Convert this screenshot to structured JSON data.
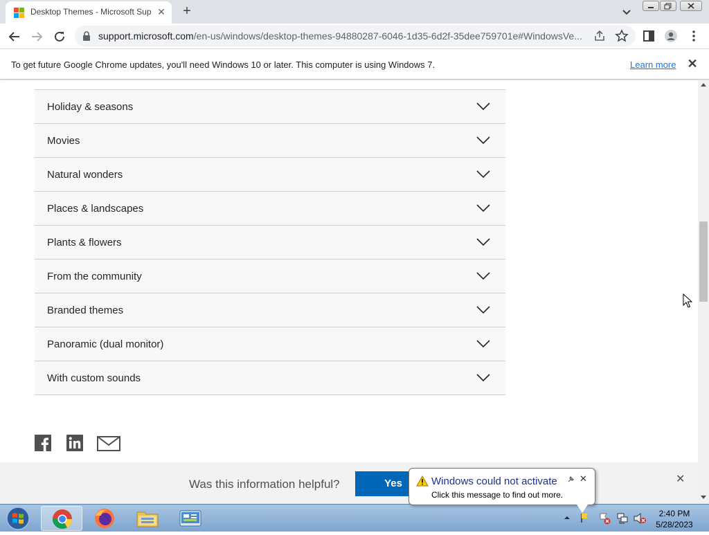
{
  "browser": {
    "tab": {
      "title": "Desktop Themes - Microsoft Sup",
      "close": "✕"
    },
    "new_tab": "+",
    "url_host": "support.microsoft.com",
    "url_path": "/en-us/windows/desktop-themes-94880287-6046-1d35-6d2f-35dee759701e#WindowsVe..."
  },
  "infobar": {
    "message": "To get future Google Chrome updates, you'll need Windows 10 or later. This computer is using Windows 7.",
    "learn_more": "Learn more",
    "close": "✕"
  },
  "accordion": {
    "items": [
      {
        "label": "Holiday & seasons"
      },
      {
        "label": "Movies"
      },
      {
        "label": "Natural wonders"
      },
      {
        "label": "Places & landscapes"
      },
      {
        "label": "Plants & flowers"
      },
      {
        "label": "From the community"
      },
      {
        "label": "Branded themes"
      },
      {
        "label": "Panoramic (dual monitor)"
      },
      {
        "label": "With custom sounds"
      }
    ]
  },
  "social": {
    "icons": [
      "facebook-icon",
      "linkedin-icon",
      "email-icon"
    ]
  },
  "feedback": {
    "question": "Was this information helpful?",
    "yes": "Yes",
    "close": "✕"
  },
  "balloon": {
    "title": "Windows could not activate",
    "message": "Click this message to find out more.",
    "close": "✕"
  },
  "taskbar": {
    "apps": [
      "chrome",
      "firefox",
      "explorer",
      "control-panel"
    ],
    "time": "2:40 PM",
    "date": "5/28/2023"
  },
  "colors": {
    "accent": "#0067b8",
    "link": "#1a73e8",
    "balloon_title": "#1e3287"
  }
}
